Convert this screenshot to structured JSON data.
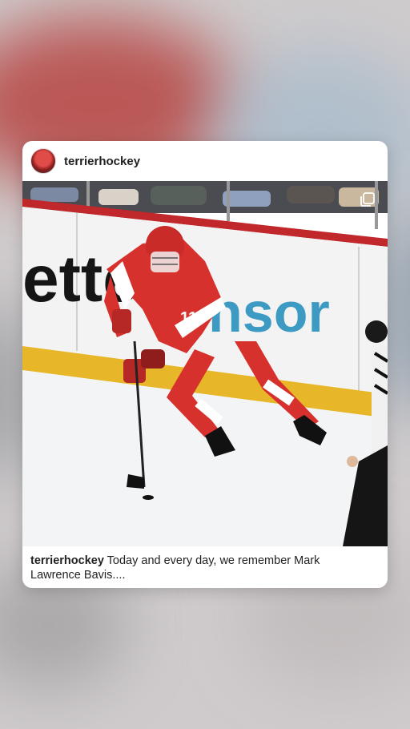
{
  "post": {
    "username": "terrierhockey",
    "caption_username": "terrierhockey",
    "caption_text": "Today and every day, we remember Mark Lawrence Bavis....",
    "board_text_left": "ette",
    "board_text_right": "nsor",
    "jersey_number": "11"
  },
  "icons": {
    "multi_photo": "multiple-photos-icon",
    "avatar": "profile-avatar"
  },
  "colors": {
    "jersey_red": "#d6312c",
    "board_yellow": "#e7b629",
    "sponsor_teal": "#3d9ac2"
  }
}
